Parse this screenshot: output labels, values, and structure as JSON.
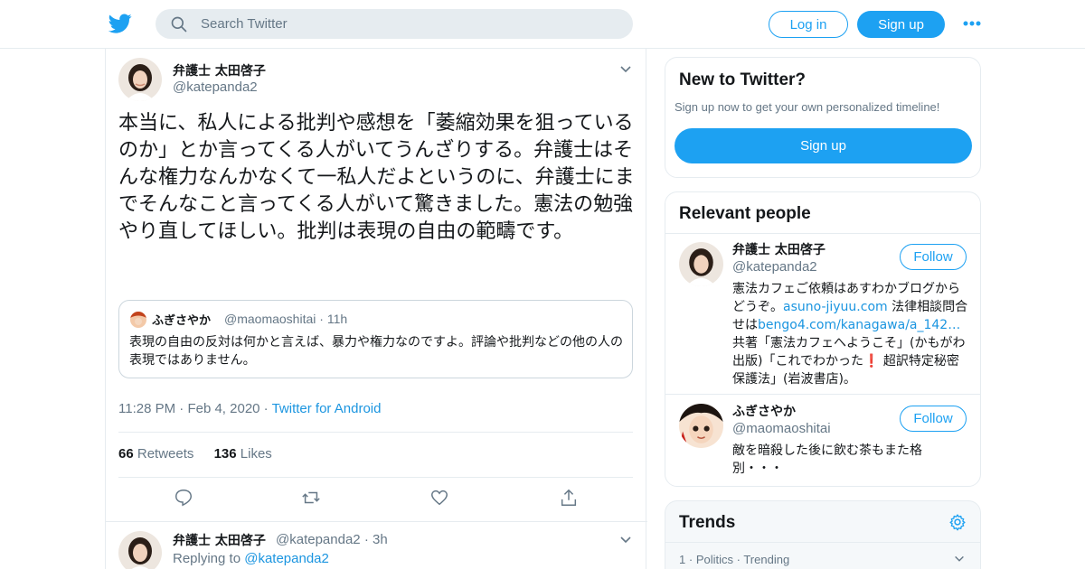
{
  "header": {
    "search_placeholder": "Search Twitter",
    "login_label": "Log in",
    "signup_label": "Sign up",
    "brand_color": "#1da1f2",
    "logo_icon": "twitter-bird-icon",
    "more_icon": "more-dots-icon"
  },
  "tweet": {
    "author_name": "弁護士 太田啓子",
    "author_handle": "@katepanda2",
    "text": "本当に、私人による批判や感想を「萎縮効果を狙っているのか」とか言ってくる人がいてうんざりする。弁護士はそんな権力なんかなくて一私人だよというのに、弁護士にまでそんなこと言ってくる人がいて驚きました。憲法の勉強やり直してほしい。批判は表現の自由の範疇です。",
    "quoted": {
      "author_name": "ふぎさやか",
      "author_handle": "@maomaoshitai",
      "time": "11h",
      "text": "表現の自由の反対は何かと言えば、暴力や権力なのですよ。評論や批判などの他の人の表現ではありません。"
    },
    "time": "11:28 PM",
    "date": "Feb 4, 2020",
    "source": "Twitter for Android",
    "retweets_count": "66",
    "retweets_label": "Retweets",
    "likes_count": "136",
    "likes_label": "Likes"
  },
  "reply": {
    "author_name": "弁護士 太田啓子",
    "author_handle": "@katepanda2",
    "time": "3h",
    "replying_prefix": "Replying to",
    "replying_to": "@katepanda2"
  },
  "sidebar": {
    "new_to_twitter": {
      "title": "New to Twitter?",
      "subtitle": "Sign up now to get your own personalized timeline!",
      "button": "Sign up"
    },
    "relevant_people": {
      "title": "Relevant people",
      "people": [
        {
          "name": "弁護士 太田啓子",
          "handle": "@katepanda2",
          "follow": "Follow",
          "bio_1": "憲法カフェご依頼はあすわかブログからどうぞ。",
          "bio_link_1": "asuno-jiyuu.com",
          "bio_2": " 法律相談問合せは",
          "bio_link_2": "bengo4.com/kanagawa/a_142…",
          "bio_3": " 共著「憲法カフェへようこそ」(かもがわ出版)「これでわかった",
          "bio_emoji": "❗",
          "bio_4": " 超訳特定秘密保護法」(岩波書店)。"
        },
        {
          "name": "ふぎさやか",
          "handle": "@maomaoshitai",
          "follow": "Follow",
          "bio_1": "敵を暗殺した後に飲む茶もまた格別・・・"
        }
      ]
    },
    "trends": {
      "title": "Trends",
      "item_rank": "1",
      "item_category": "Politics",
      "item_status": "Trending"
    }
  }
}
